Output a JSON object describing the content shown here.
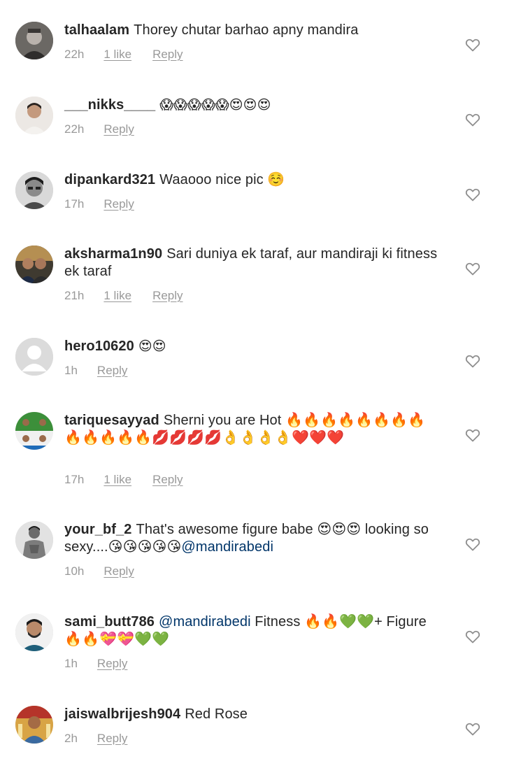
{
  "comments": [
    {
      "username": "talhaalam",
      "text": "Thorey chutar barhao apny mandira",
      "time": "22h",
      "likes": "1 like",
      "reply": "Reply"
    },
    {
      "username": "___nikks____",
      "text": "😱😱😱😱😱😍😍😍",
      "time": "22h",
      "reply": "Reply"
    },
    {
      "username": "dipankard321",
      "text": "Waaooo nice pic ☺️",
      "time": "17h",
      "reply": "Reply"
    },
    {
      "username": "aksharma1n90",
      "text": "Sari duniya ek taraf, aur mandiraji ki fitness ek taraf",
      "time": "21h",
      "likes": "1 like",
      "reply": "Reply"
    },
    {
      "username": "hero10620",
      "text": "😍😍",
      "time": "1h",
      "reply": "Reply"
    },
    {
      "username": "tariquesayyad",
      "text": "Sherni you are Hot 🔥🔥🔥🔥🔥🔥🔥🔥🔥🔥🔥🔥🔥💋💋💋💋👌👌👌👌❤️❤️❤️",
      "time": "17h",
      "likes": "1 like",
      "reply": "Reply"
    },
    {
      "username": "your_bf_2",
      "text_before": "That's awesome figure babe 😍😍😍 looking so sexy....😘😘😘😘😘",
      "mention": "@mandirabedi",
      "time": "10h",
      "reply": "Reply"
    },
    {
      "username": "sami_butt786",
      "mention": "@mandirabedi",
      "text_after": " Fitness 🔥🔥💚💚+ Figure🔥🔥💝💝💚💚",
      "time": "1h",
      "reply": "Reply"
    },
    {
      "username": "jaiswalbrijesh904",
      "text": "Red Rose",
      "time": "2h",
      "reply": "Reply"
    }
  ],
  "icons": {
    "like": "heart-outline-icon"
  },
  "colors": {
    "text": "#262626",
    "meta": "#999999",
    "mention": "#003569",
    "heart_stroke": "#8e8e8e"
  }
}
